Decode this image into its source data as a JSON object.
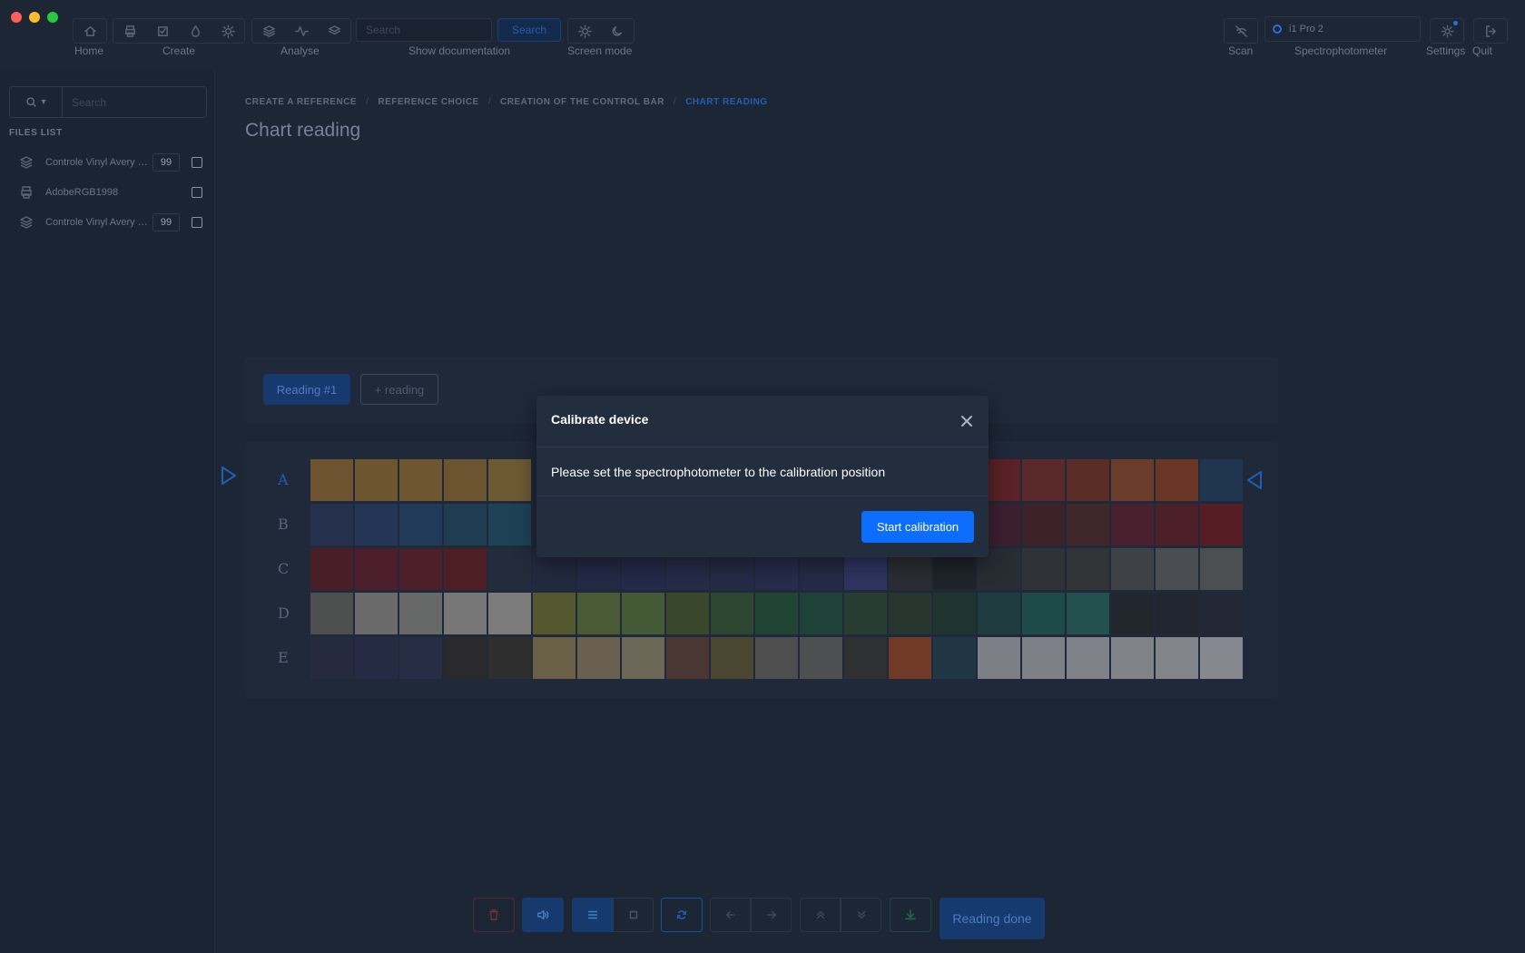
{
  "window": {
    "traffic_colors": [
      "#ff5f57",
      "#febc2e",
      "#28c840"
    ]
  },
  "toolbar": {
    "home_label": "Home",
    "create_label": "Create",
    "analyse_label": "Analyse",
    "search_placeholder": "Search",
    "search_button": "Search",
    "show_documentation_label": "Show documentation",
    "screen_mode_label": "Screen mode",
    "scan_label": "Scan",
    "device_value": "i1 Pro 2",
    "spectrophotometer_label": "Spectrophotometer",
    "settings_label": "Settings",
    "quit_label": "Quit",
    "icons": [
      "home-icon",
      "print-icon",
      "checkbox-icon",
      "drop-icon",
      "sun-icon",
      "layers-icon",
      "activity-icon",
      "stack-icon",
      "sun-icon",
      "moon-icon",
      "scan-off-icon",
      "gear-icon",
      "logout-icon"
    ]
  },
  "sidebar": {
    "search_placeholder": "Search",
    "files_title": "FILES LIST",
    "files": [
      {
        "name": "Controle Vinyl Avery - ...",
        "badge": "99",
        "icon": "layers-icon"
      },
      {
        "name": "AdobeRGB1998",
        "badge": "",
        "icon": "print-icon"
      },
      {
        "name": "Controle Vinyl Avery - ...",
        "badge": "99",
        "icon": "layers-icon"
      }
    ]
  },
  "breadcrumb": {
    "items": [
      "CREATE A REFERENCE",
      "REFERENCE CHOICE",
      "CREATION OF THE CONTROL BAR",
      "CHART READING"
    ],
    "separator": "/"
  },
  "page": {
    "title": "Chart reading"
  },
  "reading": {
    "tab_label": "Reading #1",
    "add_label": "+ reading"
  },
  "chart": {
    "row_labels": [
      "A",
      "B",
      "C",
      "D",
      "E"
    ],
    "rows": [
      [
        "#6d5330",
        "#6d5530",
        "#6d5630",
        "#6a5530",
        "#6d5a33",
        "#000",
        "#000",
        "#000",
        "#000",
        "#000",
        "#000",
        "#000",
        "#000",
        "#000",
        "#000",
        "#5a2226",
        "#5a2a2a",
        "#5a2c26",
        "#6a3c2a",
        "#6a3626",
        "#1f3550"
      ],
      [
        "#25304c",
        "#243555",
        "#223a5a",
        "#1f3c52",
        "#1d4256",
        "#000",
        "#000",
        "#000",
        "#000",
        "#000",
        "#000",
        "#000",
        "#000",
        "#000",
        "#000",
        "#3d2030",
        "#3d2229",
        "#40272a",
        "#48202e",
        "#4d1f27",
        "#561e24"
      ],
      [
        "#4a1e26",
        "#4c1e2b",
        "#4c1f29",
        "#4d1f24",
        "#242b3d",
        "#222a40",
        "#232a45",
        "#242a48",
        "#262c48",
        "#252b46",
        "#262c4a",
        "#252b46",
        "#2e345f",
        "#2a2d33",
        "#1f232b",
        "#282c33",
        "#2f3236",
        "#313437",
        "#3e4145",
        "#4a4d51",
        "#4b4f52"
      ],
      [
        "#4d4f4f",
        "#6a6a6b",
        "#676868",
        "#777777",
        "#7b7b7c",
        "#54582f",
        "#4a5a34",
        "#445a36",
        "#39482a",
        "#2c4630",
        "#224434",
        "#1f4138",
        "#283c32",
        "#26362e",
        "#1f342f",
        "#1e3c40",
        "#1e4a4a",
        "#245050",
        "#22262d",
        "#222631",
        "#222736"
      ],
      [
        "#252a3f",
        "#252b42",
        "#262d44",
        "#2a2a2c",
        "#2e2e2f",
        "#6a6048",
        "#6a6050",
        "#6b6656",
        "#4a3632",
        "#4a4632",
        "#4e4e4f",
        "#4e4f50",
        "#2e3032",
        "#703a26",
        "#213644",
        "#7c7f85",
        "#7d8086",
        "#7e8187",
        "#808388",
        "#818489",
        "#85888e"
      ]
    ]
  },
  "bottom_toolbar": {
    "done_label": "Reading done",
    "icons": [
      "trash-icon",
      "speaker-icon",
      "list-icon",
      "square-icon",
      "refresh-icon",
      "arrow-left-icon",
      "arrow-right-icon",
      "chevrons-up-icon",
      "chevrons-down-icon",
      "download-icon"
    ]
  },
  "modal": {
    "title": "Calibrate device",
    "message": "Please set the spectrophotometer to the calibration position",
    "button": "Start calibration"
  }
}
